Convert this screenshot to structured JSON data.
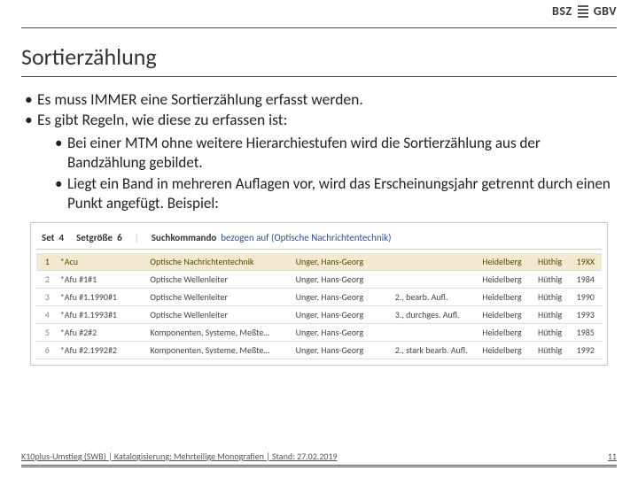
{
  "brand": {
    "left": "BSZ",
    "right": "GBV"
  },
  "title": "Sortierzählung",
  "bullets": {
    "b1": "Es muss IMMER eine Sortierzählung erfasst werden.",
    "b2": "Es gibt Regeln, wie diese zu erfassen ist:",
    "sub1": "Bei einer MTM ohne weitere Hierarchiestufen wird die Sortierzählung aus der Bandzählung gebildet.",
    "sub2": "Liegt ein Band in mehreren Auflagen vor, wird das Erscheinungsjahr getrennt durch einen Punkt angefügt. Beispiel:"
  },
  "shot": {
    "setLabel": "Set",
    "setVal": "4",
    "sizeLabel": "Setgröße",
    "sizeVal": "6",
    "cmdLabel": "Suchkommando",
    "cmdVal": "bezogen auf (Optische Nachrichtentechnik)"
  },
  "rows": [
    {
      "n": "1",
      "code": "*Acu",
      "title": "Optische Nachrichtentechnik",
      "author": "Unger, Hans-Georg",
      "ed": "",
      "place": "Heidelberg",
      "pub": "Hüthig",
      "yr": "19XX"
    },
    {
      "n": "2",
      "code": "*Afu   #1#1",
      "title": "Optische Wellenleiter",
      "author": "Unger, Hans-Georg",
      "ed": "",
      "place": "Heidelberg",
      "pub": "Hüthig",
      "yr": "1984"
    },
    {
      "n": "3",
      "code": "*Afu   #1.1990#1",
      "title": "Optische Wellenleiter",
      "author": "Unger, Hans-Georg",
      "ed": "2., bearb. Aufl.",
      "place": "Heidelberg",
      "pub": "Hüthig",
      "yr": "1990"
    },
    {
      "n": "4",
      "code": "*Afu   #1.1993#1",
      "title": "Optische Wellenleiter",
      "author": "Unger, Hans-Georg",
      "ed": "3., durchges. Aufl.",
      "place": "Heidelberg",
      "pub": "Hüthig",
      "yr": "1993"
    },
    {
      "n": "5",
      "code": "*Afu   #2#2",
      "title": "Komponenten, Systeme, Meßte…",
      "author": "Unger, Hans-Georg",
      "ed": "",
      "place": "Heidelberg",
      "pub": "Hüthig",
      "yr": "1985"
    },
    {
      "n": "6",
      "code": "*Afu   #2.1992#2",
      "title": "Komponenten, Systeme, Meßte…",
      "author": "Unger, Hans-Georg",
      "ed": "2., stark bearb. Aufl.",
      "place": "Heidelberg",
      "pub": "Hüthig",
      "yr": "1992"
    }
  ],
  "footer": {
    "text": "K10plus-Umstieg (SWB) | Katalogisierung: Mehrteilige Monografien | Stand: 27.02.2019",
    "page": "11"
  }
}
